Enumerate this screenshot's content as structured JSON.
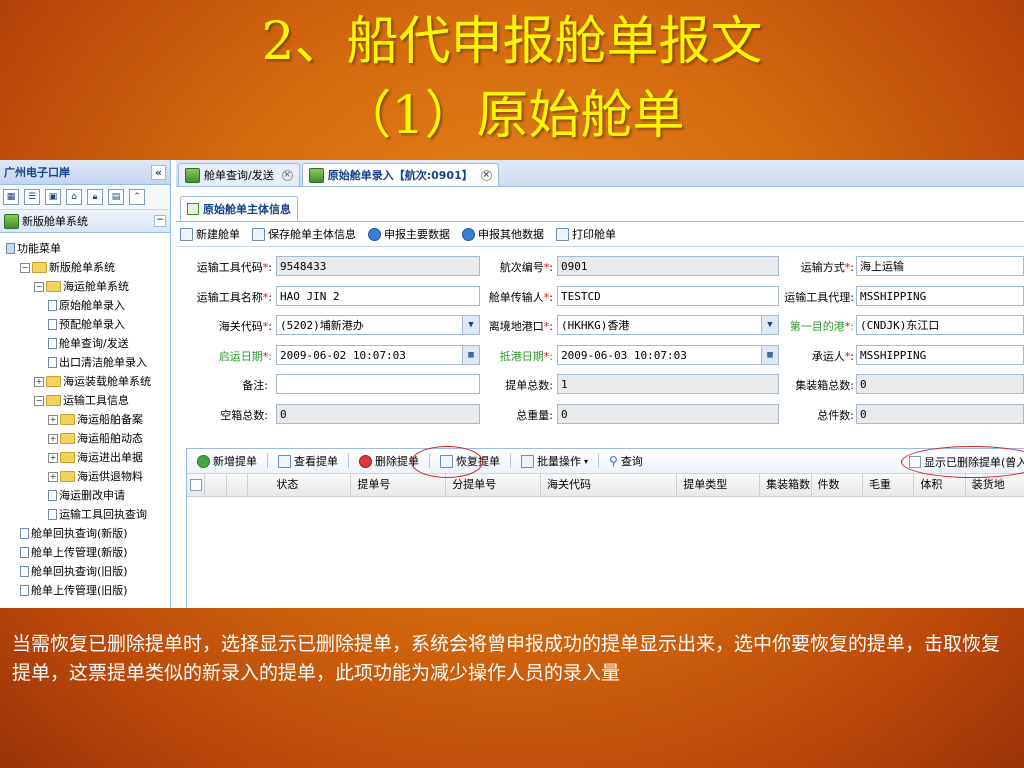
{
  "slide": {
    "title_line1": "2、船代申报舱单报文",
    "title_line2": "（1）原始舱单",
    "caption": "当需恢复已删除提单时，选择显示已删除提单，系统会将曾申报成功的提单显示出来，选中你要恢复的提单，击取恢复提单，这票提单类似的新录入的提单，此项功能为减少操作人员的录入量"
  },
  "sidebar": {
    "header": "广州电子口岸",
    "collapse": "«",
    "panel_title": "新版舱单系统",
    "tree": [
      {
        "label": "功能菜单",
        "type": "root",
        "indent": 0
      },
      {
        "label": "新版舱单系统",
        "type": "folder",
        "indent": 1
      },
      {
        "label": "海运舱单系统",
        "type": "folder",
        "indent": 2
      },
      {
        "label": "原始舱单录入",
        "type": "doc",
        "indent": 3
      },
      {
        "label": "预配舱单录入",
        "type": "doc",
        "indent": 3
      },
      {
        "label": "舱单查询/发送",
        "type": "doc",
        "indent": 3
      },
      {
        "label": "出口清洁舱单录入",
        "type": "doc",
        "indent": 3
      },
      {
        "label": "海运装载舱单系统",
        "type": "folder-plus",
        "indent": 2
      },
      {
        "label": "运输工具信息",
        "type": "folder",
        "indent": 2
      },
      {
        "label": "海运船舶备案",
        "type": "folder-plus",
        "indent": 3
      },
      {
        "label": "海运船舶动态",
        "type": "folder-plus",
        "indent": 3
      },
      {
        "label": "海运进出单据",
        "type": "folder-plus",
        "indent": 3
      },
      {
        "label": "海运供退物料",
        "type": "folder-plus",
        "indent": 3
      },
      {
        "label": "海运删改申请",
        "type": "doc",
        "indent": 3
      },
      {
        "label": "运输工具回执查询",
        "type": "doc",
        "indent": 3
      },
      {
        "label": "舱单回执查询(新版)",
        "type": "doc",
        "indent": 1
      },
      {
        "label": "舱单上传管理(新版)",
        "type": "doc",
        "indent": 1
      },
      {
        "label": "舱单回执查询(旧版)",
        "type": "doc",
        "indent": 1
      },
      {
        "label": "舱单上传管理(旧版)",
        "type": "doc",
        "indent": 1
      }
    ]
  },
  "tabs": [
    {
      "label": "舱单查询/发送"
    },
    {
      "label": "原始舱单录入【航次:0901】"
    }
  ],
  "subtab": "原始舱单主体信息",
  "toolbar": [
    "新建舱单",
    "保存舱单主体信息",
    "申报主要数据",
    "申报其他数据",
    "打印舱单"
  ],
  "form": {
    "transport_code_label": "运输工具代码",
    "transport_code": "9548433",
    "voyage_label": "航次编号",
    "voyage": "0901",
    "transport_mode_label": "运输方式",
    "transport_mode": "海上运输",
    "transport_name_label": "运输工具名称",
    "transport_name": "HAO JIN 2",
    "entry_person_label": "舱单传输人",
    "entry_person": "TESTCD",
    "agent_label": "运输工具代理",
    "agent": "MSSHIPPING",
    "customs_label": "海关代码",
    "customs": "(5202)埔新港办",
    "departure_port_label": "离境地港口",
    "departure_port": "(HKHKG)香港",
    "dest_port_label": "第一目的港",
    "dest_port": "(CNDJK)东江口",
    "depart_date_label": "启运日期",
    "depart_date": "2009-06-02 10:07:03",
    "arrive_date_label": "抵港日期",
    "arrive_date": "2009-06-03 10:07:03",
    "carrier_label": "承运人",
    "carrier": "MSSHIPPING",
    "remark_label": "备注:",
    "remark": "",
    "bill_total_label": "提单总数:",
    "bill_total": "1",
    "container_total_label": "集装箱总数:",
    "container_total": "0",
    "empty_total_label": "空箱总数:",
    "empty_total": "0",
    "weight_total_label": "总重量:",
    "weight_total": "0",
    "pieces_total_label": "总件数:",
    "pieces_total": "0"
  },
  "grid_toolbar": {
    "add": "新增提单",
    "view": "查看提单",
    "delete": "删除提单",
    "restore": "恢复提单",
    "batch": "批量操作",
    "query": "查询",
    "show_deleted": "显示已删除提单(曾入"
  },
  "grid_columns": [
    "状态",
    "提单号",
    "分提单号",
    "海关代码",
    "提单类型",
    "集装箱数",
    "件数",
    "毛重",
    "体积",
    "装货地"
  ],
  "colors": {
    "title": "#fff700",
    "panel_border": "#99bbe8",
    "panel_text": "#15428b",
    "annotation": "#d02020"
  }
}
